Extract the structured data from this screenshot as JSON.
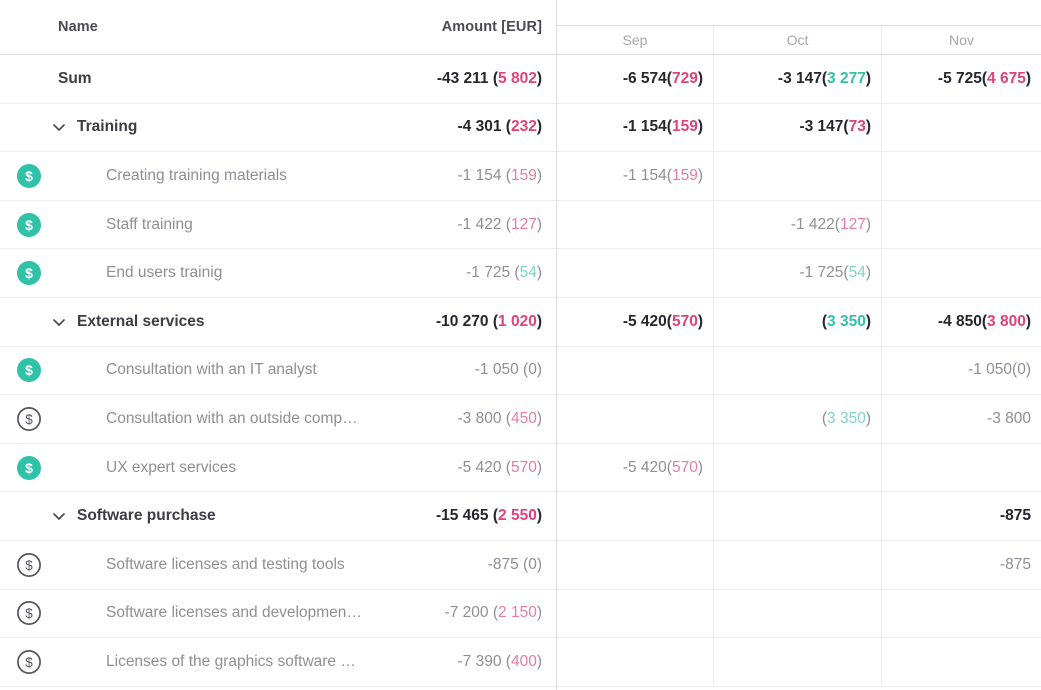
{
  "colors": {
    "accent_teal": "#2fc2a9",
    "accent_pink": "#e0427a",
    "text_dark": "#262630",
    "text_muted": "#8e8e96"
  },
  "header": {
    "name_label": "Name",
    "amount_label": "Amount [EUR]",
    "months": [
      "Sep",
      "Oct",
      "Nov"
    ]
  },
  "rows": [
    {
      "level": "sum",
      "icon": "none",
      "label": "Sum",
      "amount": {
        "main": "-43 211 ",
        "paren_open": "(",
        "paren": "5 802",
        "paren_tone": "pink",
        "paren_close": ")"
      },
      "cells": [
        {
          "main": "-6 574",
          "paren_open": "(",
          "paren": "729",
          "paren_tone": "pink",
          "paren_close": ")"
        },
        {
          "main": "-3 147",
          "paren_open": "(",
          "paren": "3 277",
          "paren_tone": "teal",
          "paren_close": ")"
        },
        {
          "main": "-5 725",
          "paren_open": "(",
          "paren": "4 675",
          "paren_tone": "pink",
          "paren_close": ")"
        }
      ]
    },
    {
      "level": "group",
      "icon": "chevron-down",
      "label": "Training",
      "amount": {
        "main": "-4 301 ",
        "paren_open": "(",
        "paren": "232",
        "paren_tone": "pink",
        "paren_close": ")"
      },
      "cells": [
        {
          "main": "-1 154",
          "paren_open": "(",
          "paren": "159",
          "paren_tone": "pink",
          "paren_close": ")"
        },
        {
          "main": "-3 147",
          "paren_open": "(",
          "paren": "73",
          "paren_tone": "pink",
          "paren_close": ")"
        },
        {
          "main": "",
          "paren_open": "",
          "paren": "",
          "paren_tone": "grey",
          "paren_close": ""
        }
      ]
    },
    {
      "level": "item",
      "icon": "dollar-filled",
      "label": "Creating training materials",
      "amount": {
        "main": "-1 154 ",
        "paren_open": "(",
        "paren": "159",
        "paren_tone": "pink",
        "paren_close": ")"
      },
      "cells": [
        {
          "main": "-1 154",
          "paren_open": "(",
          "paren": "159",
          "paren_tone": "pink",
          "paren_close": ")"
        },
        {
          "main": "",
          "paren_open": "",
          "paren": "",
          "paren_tone": "grey",
          "paren_close": ""
        },
        {
          "main": "",
          "paren_open": "",
          "paren": "",
          "paren_tone": "grey",
          "paren_close": ""
        }
      ]
    },
    {
      "level": "item",
      "icon": "dollar-filled",
      "label": "Staff training",
      "amount": {
        "main": "-1 422 ",
        "paren_open": "(",
        "paren": "127",
        "paren_tone": "pink",
        "paren_close": ")"
      },
      "cells": [
        {
          "main": "",
          "paren_open": "",
          "paren": "",
          "paren_tone": "grey",
          "paren_close": ""
        },
        {
          "main": "-1 422",
          "paren_open": "(",
          "paren": "127",
          "paren_tone": "pink",
          "paren_close": ")"
        },
        {
          "main": "",
          "paren_open": "",
          "paren": "",
          "paren_tone": "grey",
          "paren_close": ""
        }
      ]
    },
    {
      "level": "item",
      "icon": "dollar-filled",
      "label": "End users trainig",
      "amount": {
        "main": "-1 725 ",
        "paren_open": "(",
        "paren": "54",
        "paren_tone": "teal",
        "paren_close": ")"
      },
      "cells": [
        {
          "main": "",
          "paren_open": "",
          "paren": "",
          "paren_tone": "grey",
          "paren_close": ""
        },
        {
          "main": "-1 725",
          "paren_open": "(",
          "paren": "54",
          "paren_tone": "teal",
          "paren_close": ")"
        },
        {
          "main": "",
          "paren_open": "",
          "paren": "",
          "paren_tone": "grey",
          "paren_close": ""
        }
      ]
    },
    {
      "level": "group",
      "icon": "chevron-down",
      "label": "External services",
      "amount": {
        "main": "-10 270 ",
        "paren_open": "(",
        "paren": "1 020",
        "paren_tone": "pink",
        "paren_close": ")"
      },
      "cells": [
        {
          "main": "-5 420",
          "paren_open": "(",
          "paren": "570",
          "paren_tone": "pink",
          "paren_close": ")"
        },
        {
          "main": "",
          "paren_open": "(",
          "paren": "3 350",
          "paren_tone": "teal",
          "paren_close": ")"
        },
        {
          "main": "-4 850",
          "paren_open": "(",
          "paren": "3 800",
          "paren_tone": "pink",
          "paren_close": ")"
        }
      ]
    },
    {
      "level": "item",
      "icon": "dollar-filled",
      "label": "Consultation with an IT analyst",
      "amount": {
        "main": "-1 050 ",
        "paren_open": "(",
        "paren": "0",
        "paren_tone": "grey",
        "paren_close": ")"
      },
      "cells": [
        {
          "main": "",
          "paren_open": "",
          "paren": "",
          "paren_tone": "grey",
          "paren_close": ""
        },
        {
          "main": "",
          "paren_open": "",
          "paren": "",
          "paren_tone": "grey",
          "paren_close": ""
        },
        {
          "main": "-1 050",
          "paren_open": "(",
          "paren": "0",
          "paren_tone": "grey",
          "paren_close": ")"
        }
      ]
    },
    {
      "level": "item",
      "icon": "dollar-outline",
      "label": "Consultation with an outside comp…",
      "amount": {
        "main": "-3 800 ",
        "paren_open": "(",
        "paren": "450",
        "paren_tone": "pink",
        "paren_close": ")"
      },
      "cells": [
        {
          "main": "",
          "paren_open": "",
          "paren": "",
          "paren_tone": "grey",
          "paren_close": ""
        },
        {
          "main": "",
          "paren_open": "(",
          "paren": "3 350",
          "paren_tone": "teal",
          "paren_close": ")"
        },
        {
          "main": "-3 800",
          "paren_open": "",
          "paren": "",
          "paren_tone": "grey",
          "paren_close": ""
        }
      ]
    },
    {
      "level": "item",
      "icon": "dollar-filled",
      "label": "UX expert services",
      "amount": {
        "main": "-5 420 ",
        "paren_open": "(",
        "paren": "570",
        "paren_tone": "pink",
        "paren_close": ")"
      },
      "cells": [
        {
          "main": "-5 420",
          "paren_open": "(",
          "paren": "570",
          "paren_tone": "pink",
          "paren_close": ")"
        },
        {
          "main": "",
          "paren_open": "",
          "paren": "",
          "paren_tone": "grey",
          "paren_close": ""
        },
        {
          "main": "",
          "paren_open": "",
          "paren": "",
          "paren_tone": "grey",
          "paren_close": ""
        }
      ]
    },
    {
      "level": "group",
      "icon": "chevron-down",
      "label": "Software purchase",
      "amount": {
        "main": "-15 465 ",
        "paren_open": "(",
        "paren": "2 550",
        "paren_tone": "pink",
        "paren_close": ")"
      },
      "cells": [
        {
          "main": "",
          "paren_open": "",
          "paren": "",
          "paren_tone": "grey",
          "paren_close": ""
        },
        {
          "main": "",
          "paren_open": "",
          "paren": "",
          "paren_tone": "grey",
          "paren_close": ""
        },
        {
          "main": "-875",
          "paren_open": "",
          "paren": "",
          "paren_tone": "grey",
          "paren_close": ""
        }
      ]
    },
    {
      "level": "item",
      "icon": "dollar-outline",
      "label": "Software licenses and testing tools",
      "amount": {
        "main": "-875 ",
        "paren_open": "(",
        "paren": "0",
        "paren_tone": "grey",
        "paren_close": ")"
      },
      "cells": [
        {
          "main": "",
          "paren_open": "",
          "paren": "",
          "paren_tone": "grey",
          "paren_close": ""
        },
        {
          "main": "",
          "paren_open": "",
          "paren": "",
          "paren_tone": "grey",
          "paren_close": ""
        },
        {
          "main": "-875",
          "paren_open": "",
          "paren": "",
          "paren_tone": "grey",
          "paren_close": ""
        }
      ]
    },
    {
      "level": "item",
      "icon": "dollar-outline",
      "label": "Software licenses and developmen…",
      "amount": {
        "main": "-7 200 ",
        "paren_open": "(",
        "paren": "2 150",
        "paren_tone": "pink",
        "paren_close": ")"
      },
      "cells": [
        {
          "main": "",
          "paren_open": "",
          "paren": "",
          "paren_tone": "grey",
          "paren_close": ""
        },
        {
          "main": "",
          "paren_open": "",
          "paren": "",
          "paren_tone": "grey",
          "paren_close": ""
        },
        {
          "main": "",
          "paren_open": "",
          "paren": "",
          "paren_tone": "grey",
          "paren_close": ""
        }
      ]
    },
    {
      "level": "item",
      "icon": "dollar-outline",
      "label": "Licenses of the graphics software …",
      "amount": {
        "main": "-7 390 ",
        "paren_open": "(",
        "paren": "400",
        "paren_tone": "pink",
        "paren_close": ")"
      },
      "cells": [
        {
          "main": "",
          "paren_open": "",
          "paren": "",
          "paren_tone": "grey",
          "paren_close": ""
        },
        {
          "main": "",
          "paren_open": "",
          "paren": "",
          "paren_tone": "grey",
          "paren_close": ""
        },
        {
          "main": "",
          "paren_open": "",
          "paren": "",
          "paren_tone": "grey",
          "paren_close": ""
        }
      ]
    }
  ]
}
